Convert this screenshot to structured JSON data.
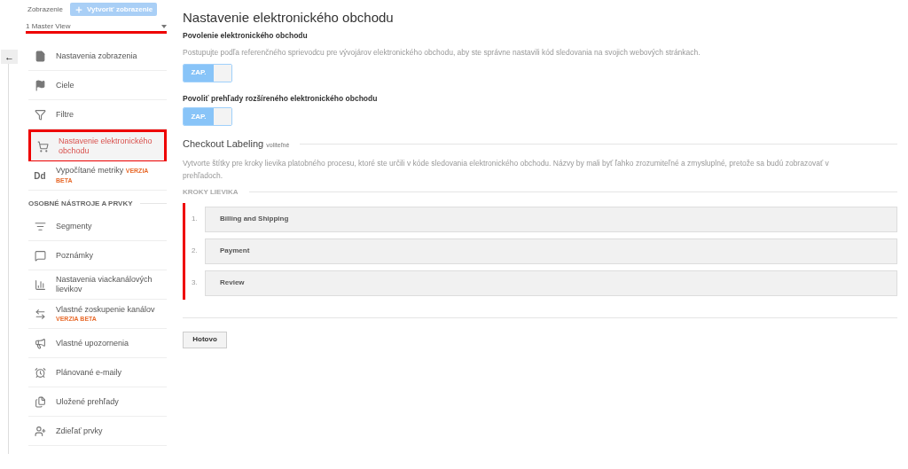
{
  "view": {
    "label": "Zobrazenie",
    "create_button": "Vytvoriť zobrazenie",
    "select_value": "1 Master View",
    "underlined": true
  },
  "back_button": {
    "label": "←"
  },
  "sidebar": {
    "groups": [
      {
        "items": [
          {
            "label": "Nastavenia zobrazenia",
            "selected": false
          },
          {
            "label": "Ciele",
            "selected": false
          },
          {
            "label": "Filtre",
            "selected": false
          },
          {
            "label": "Nastavenie elektronického obchodu",
            "selected": true
          },
          {
            "label": "Vypočítané metriky",
            "badge": "VERZIA BETA",
            "kind": "inline-badge",
            "icon_text": "Dd",
            "selected": false
          }
        ]
      },
      {
        "heading": "OSOBNÉ NÁSTROJE A PRVKY",
        "items": [
          {
            "label": "Segmenty",
            "selected": false
          },
          {
            "label": "Poznámky",
            "selected": false
          },
          {
            "label": "Nastavenia viackanálových lievikov",
            "selected": false
          },
          {
            "label": "Vlastné zoskupenie kanálov",
            "badge": "VERZIA BETA",
            "kind": "block-badge",
            "selected": false
          },
          {
            "label": "Vlastné upozornenia",
            "selected": false
          },
          {
            "label": "Plánované e-maily",
            "selected": false
          },
          {
            "label": "Uložené prehľady",
            "selected": false
          },
          {
            "label": "Zdieľať prvky",
            "selected": false
          }
        ]
      }
    ]
  },
  "main": {
    "title": "Nastavenie elektronického obchodu",
    "ecommerce": {
      "heading": "Povolenie elektronického obchodu",
      "description": "Postupujte podľa referenčného sprievodcu pre vývojárov elektronického obchodu, aby ste správne nastavili kód sledovania na svojich webových stránkach.",
      "toggle": {
        "label": "ZAP.",
        "on": true
      }
    },
    "enhanced": {
      "heading": "Povoliť prehľady rozšíreného elektronického obchodu",
      "toggle": {
        "label": "ZAP.",
        "on": true
      }
    },
    "checkout": {
      "title": "Checkout Labeling",
      "optional": "voliteľné",
      "description": "Vytvorte štítky pre kroky lievika platobného procesu, ktoré ste určili v kóde sledovania elektronického obchodu. Názvy by mali byť ľahko zrozumiteľné a zmysluplné, pretože sa budú zobrazovať v prehľadoch.",
      "steps_heading": "KROKY LIEVIKA",
      "marked": true,
      "steps": [
        {
          "number": "1.",
          "name": "Billing and Shipping"
        },
        {
          "number": "2.",
          "name": "Payment"
        },
        {
          "number": "3.",
          "name": "Review"
        }
      ]
    },
    "done_button": "Hotovo"
  }
}
